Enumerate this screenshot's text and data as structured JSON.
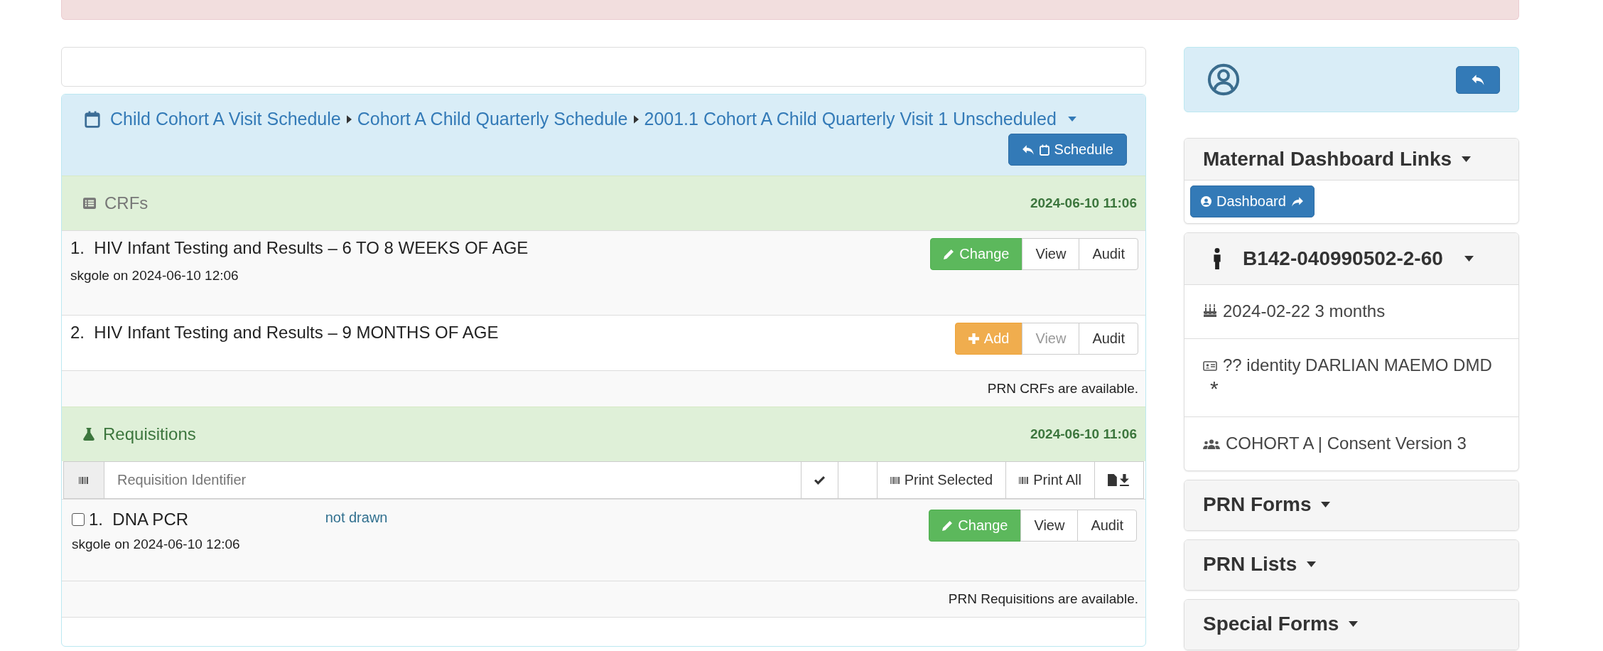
{
  "breadcrumb": {
    "items": [
      "Child Cohort A Visit Schedule",
      "Cohort A Child Quarterly Schedule",
      "2001.1 Cohort A Child Quarterly Visit 1 Unscheduled"
    ],
    "back_button": "Schedule"
  },
  "crfs": {
    "title": "CRFs",
    "timestamp": "2024-06-10 11:06",
    "rows": [
      {
        "number": "1.",
        "title": "HIV Infant Testing and Results – 6 TO 8 WEEKS OF AGE",
        "subtitle": "skgole on 2024-06-10 12:06",
        "actions": [
          {
            "kind": "change",
            "label": "Change",
            "disabled": false
          },
          {
            "kind": "view",
            "label": "View",
            "disabled": false
          },
          {
            "kind": "audit",
            "label": "Audit",
            "disabled": false
          }
        ]
      },
      {
        "number": "2.",
        "title": "HIV Infant Testing and Results – 9 MONTHS OF AGE",
        "actions": [
          {
            "kind": "add",
            "label": "Add",
            "disabled": false
          },
          {
            "kind": "view",
            "label": "View",
            "disabled": true
          },
          {
            "kind": "audit",
            "label": "Audit",
            "disabled": false
          }
        ]
      }
    ],
    "note": "PRN CRFs are available."
  },
  "requisitions": {
    "title": "Requisitions",
    "timestamp": "2024-06-10 11:06",
    "search": {
      "placeholder": "Requisition Identifier"
    },
    "print_selected": "Print Selected",
    "print_all": "Print All",
    "rows": [
      {
        "number": "1.",
        "title": "DNA PCR",
        "checked": false,
        "status": "not drawn",
        "subtitle": "skgole on 2024-06-10 12:06",
        "actions": [
          {
            "kind": "change",
            "label": "Change",
            "disabled": false
          },
          {
            "kind": "view",
            "label": "View",
            "disabled": false
          },
          {
            "kind": "audit",
            "label": "Audit",
            "disabled": false
          }
        ]
      }
    ],
    "note": "PRN Requisitions are available."
  },
  "sidebar": {
    "links": {
      "title": "Maternal Dashboard Links",
      "button": "Dashboard"
    },
    "subject": {
      "identifier": "B142-040990502-2-60",
      "items": [
        {
          "kind": "birth",
          "text": "2024-02-22 3 months"
        },
        {
          "kind": "identity",
          "text": "?? identity DARLIAN MAEMO DMD",
          "mark": "*"
        },
        {
          "kind": "cohort",
          "text": "COHORT A | Consent Version 3"
        }
      ]
    },
    "sections": [
      "PRN Forms",
      "PRN Lists",
      "Special Forms"
    ]
  }
}
